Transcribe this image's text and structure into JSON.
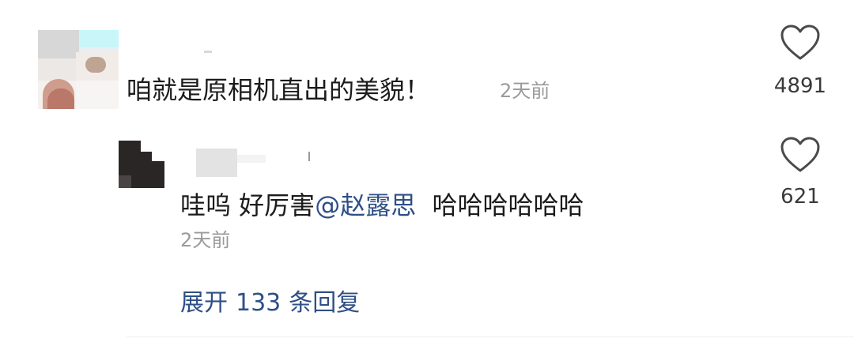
{
  "comment": {
    "text": "咱就是原相机直出的美貌！",
    "time": "2天前",
    "likes": "4891",
    "like_icon": "heart-outline-icon"
  },
  "reply": {
    "text_before": "哇呜 好厉害",
    "mention": "@赵露思",
    "text_after": "哈哈哈哈哈哈",
    "time": "2天前",
    "likes": "621",
    "like_icon": "heart-outline-icon"
  },
  "expand": {
    "word1": "展开",
    "count": "133",
    "word2": "条回复"
  },
  "colors": {
    "link": "#2f4f86",
    "meta": "#9a9a9a",
    "text": "#1b1b1b"
  }
}
